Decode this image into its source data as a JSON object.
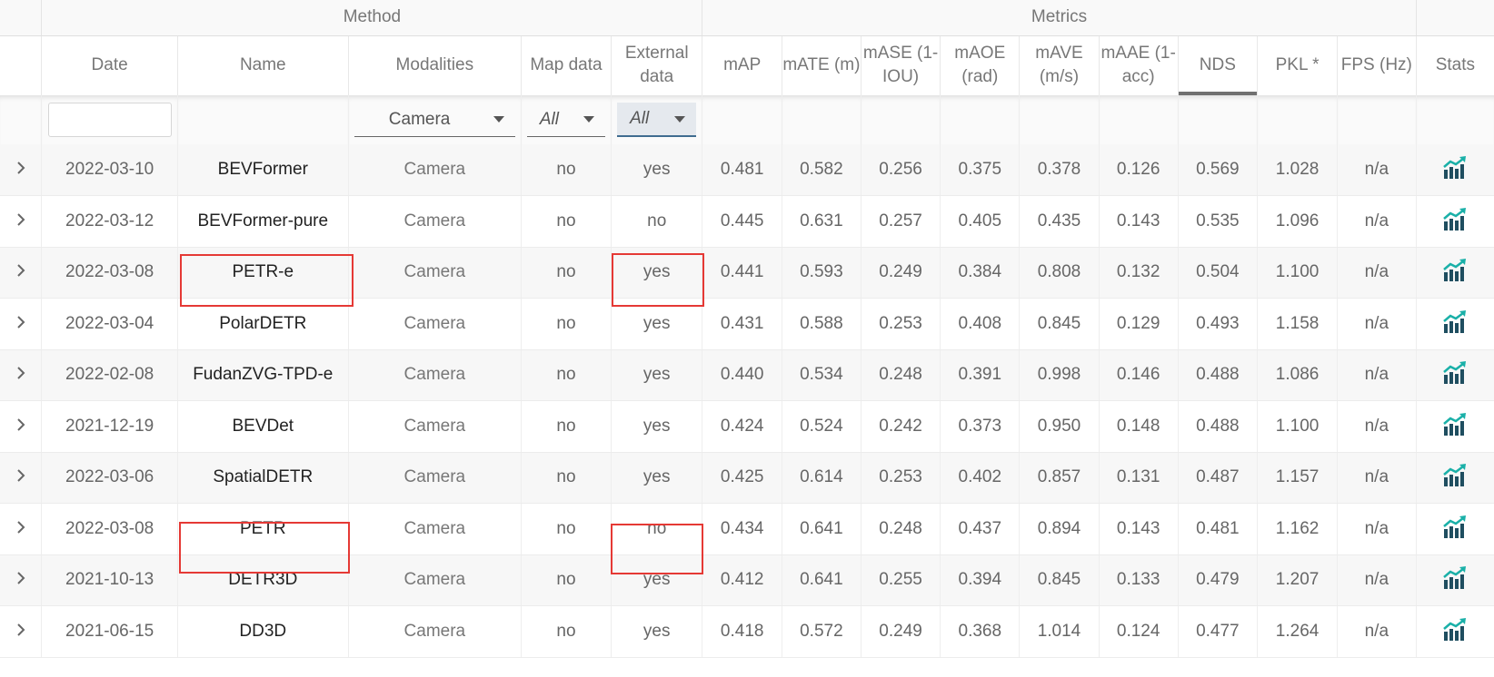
{
  "groups": {
    "method": "Method",
    "metrics": "Metrics"
  },
  "columns": {
    "date": "Date",
    "name": "Name",
    "modalities": "Modalities",
    "map_data": "Map data",
    "external_data": "External data",
    "map": "mAP",
    "mate": "mATE (m)",
    "mase": "mASE (1-IOU)",
    "maoe": "mAOE (rad)",
    "mave": "mAVE (m/s)",
    "maae": "mAAE (1-acc)",
    "nds": "NDS",
    "pkl": "PKL *",
    "fps": "FPS (Hz)",
    "stats": "Stats"
  },
  "sorted_column": "NDS",
  "filters": {
    "date": "",
    "modalities": "Camera",
    "map_data": "All",
    "external_data": "All"
  },
  "icons": {
    "expand": "chevron-right-icon",
    "stats": "chart-trend-icon"
  },
  "colors": {
    "highlight": "#e53935",
    "stats_icon": "#1f4e60",
    "stats_arrow": "#1ab0a8",
    "active_filter": "#e5e9ee"
  },
  "rows": [
    {
      "date": "2022-03-10",
      "name": "BEVFormer",
      "modalities": "Camera",
      "map_data": "no",
      "external_data": "yes",
      "map": "0.481",
      "mate": "0.582",
      "mase": "0.256",
      "maoe": "0.375",
      "mave": "0.378",
      "maae": "0.126",
      "nds": "0.569",
      "pkl": "1.028",
      "fps": "n/a"
    },
    {
      "date": "2022-03-12",
      "name": "BEVFormer-pure",
      "modalities": "Camera",
      "map_data": "no",
      "external_data": "no",
      "map": "0.445",
      "mate": "0.631",
      "mase": "0.257",
      "maoe": "0.405",
      "mave": "0.435",
      "maae": "0.143",
      "nds": "0.535",
      "pkl": "1.096",
      "fps": "n/a"
    },
    {
      "date": "2022-03-08",
      "name": "PETR-e",
      "modalities": "Camera",
      "map_data": "no",
      "external_data": "yes",
      "map": "0.441",
      "mate": "0.593",
      "mase": "0.249",
      "maoe": "0.384",
      "mave": "0.808",
      "maae": "0.132",
      "nds": "0.504",
      "pkl": "1.100",
      "fps": "n/a"
    },
    {
      "date": "2022-03-04",
      "name": "PolarDETR",
      "modalities": "Camera",
      "map_data": "no",
      "external_data": "yes",
      "map": "0.431",
      "mate": "0.588",
      "mase": "0.253",
      "maoe": "0.408",
      "mave": "0.845",
      "maae": "0.129",
      "nds": "0.493",
      "pkl": "1.158",
      "fps": "n/a"
    },
    {
      "date": "2022-02-08",
      "name": "FudanZVG-TPD-e",
      "modalities": "Camera",
      "map_data": "no",
      "external_data": "yes",
      "map": "0.440",
      "mate": "0.534",
      "mase": "0.248",
      "maoe": "0.391",
      "mave": "0.998",
      "maae": "0.146",
      "nds": "0.488",
      "pkl": "1.086",
      "fps": "n/a"
    },
    {
      "date": "2021-12-19",
      "name": "BEVDet",
      "modalities": "Camera",
      "map_data": "no",
      "external_data": "yes",
      "map": "0.424",
      "mate": "0.524",
      "mase": "0.242",
      "maoe": "0.373",
      "mave": "0.950",
      "maae": "0.148",
      "nds": "0.488",
      "pkl": "1.100",
      "fps": "n/a"
    },
    {
      "date": "2022-03-06",
      "name": "SpatialDETR",
      "modalities": "Camera",
      "map_data": "no",
      "external_data": "yes",
      "map": "0.425",
      "mate": "0.614",
      "mase": "0.253",
      "maoe": "0.402",
      "mave": "0.857",
      "maae": "0.131",
      "nds": "0.487",
      "pkl": "1.157",
      "fps": "n/a"
    },
    {
      "date": "2022-03-08",
      "name": "PETR",
      "modalities": "Camera",
      "map_data": "no",
      "external_data": "no",
      "map": "0.434",
      "mate": "0.641",
      "mase": "0.248",
      "maoe": "0.437",
      "mave": "0.894",
      "maae": "0.143",
      "nds": "0.481",
      "pkl": "1.162",
      "fps": "n/a"
    },
    {
      "date": "2021-10-13",
      "name": "DETR3D",
      "modalities": "Camera",
      "map_data": "no",
      "external_data": "yes",
      "map": "0.412",
      "mate": "0.641",
      "mase": "0.255",
      "maoe": "0.394",
      "mave": "0.845",
      "maae": "0.133",
      "nds": "0.479",
      "pkl": "1.207",
      "fps": "n/a"
    },
    {
      "date": "2021-06-15",
      "name": "DD3D",
      "modalities": "Camera",
      "map_data": "no",
      "external_data": "yes",
      "map": "0.418",
      "mate": "0.572",
      "mase": "0.249",
      "maoe": "0.368",
      "mave": "1.014",
      "maae": "0.124",
      "nds": "0.477",
      "pkl": "1.264",
      "fps": "n/a"
    }
  ]
}
